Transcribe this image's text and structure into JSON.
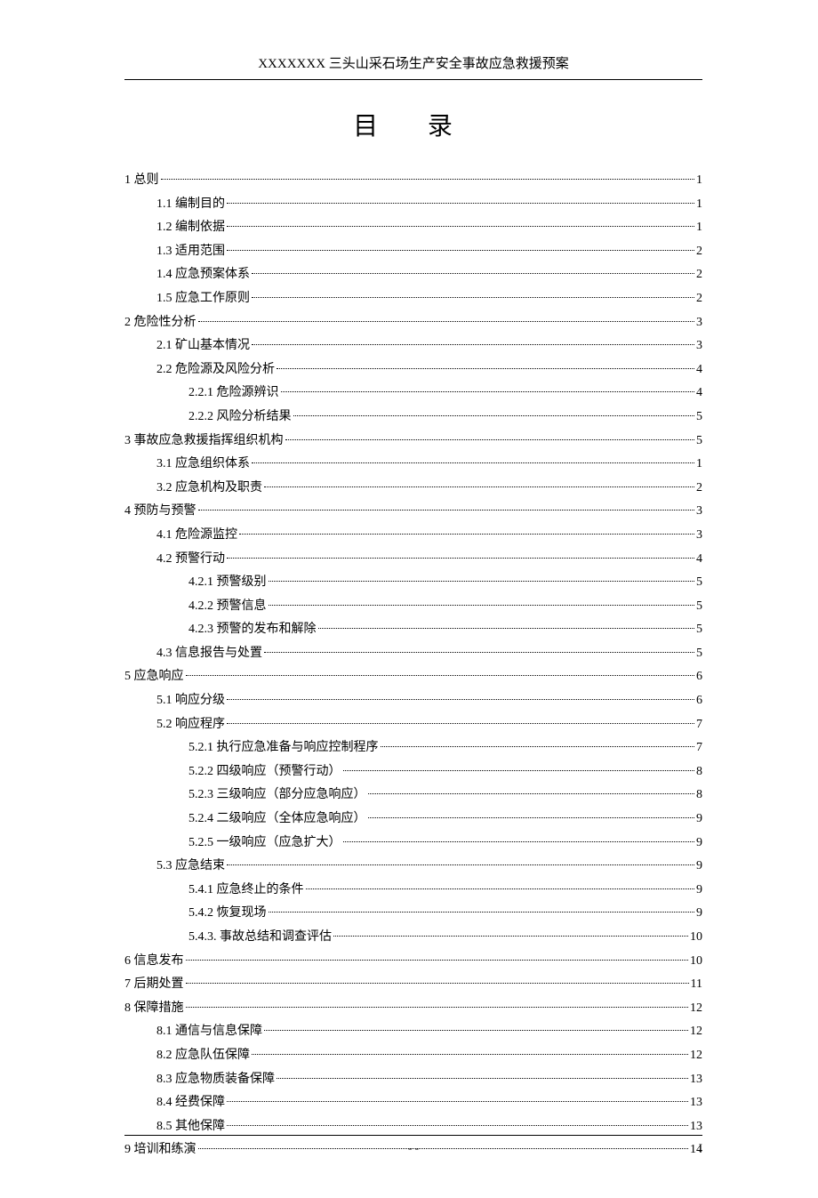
{
  "header": "XXXXXXX 三头山采石场生产安全事故应急救援预案",
  "title": "目 录",
  "footer_center": "-  -",
  "footer_right": "I",
  "toc": [
    {
      "level": 1,
      "label": "1 总则",
      "page": "1"
    },
    {
      "level": 2,
      "label": "1.1 编制目的",
      "page": "1"
    },
    {
      "level": 2,
      "label": "1.2 编制依据",
      "page": "1"
    },
    {
      "level": 2,
      "label": "1.3 适用范围",
      "page": "2"
    },
    {
      "level": 2,
      "label": "1.4 应急预案体系",
      "page": "2"
    },
    {
      "level": 2,
      "label": "1.5 应急工作原则",
      "page": "2"
    },
    {
      "level": 1,
      "label": "2 危险性分析",
      "page": "3"
    },
    {
      "level": 2,
      "label": "2.1 矿山基本情况",
      "page": "3"
    },
    {
      "level": 2,
      "label": "2.2 危险源及风险分析",
      "page": "4"
    },
    {
      "level": 3,
      "label": "2.2.1 危险源辨识",
      "page": "4"
    },
    {
      "level": 3,
      "label": "2.2.2 风险分析结果",
      "page": "5"
    },
    {
      "level": 1,
      "label": "3 事故应急救援指挥组织机构",
      "page": "5"
    },
    {
      "level": 2,
      "label": "3.1 应急组织体系",
      "page": "1"
    },
    {
      "level": 2,
      "label": "3.2 应急机构及职责",
      "page": "2"
    },
    {
      "level": 1,
      "label": "4 预防与预警",
      "page": "3"
    },
    {
      "level": 2,
      "label": "4.1 危险源监控",
      "page": "3"
    },
    {
      "level": 2,
      "label": "4.2 预警行动",
      "page": "4"
    },
    {
      "level": 3,
      "label": "4.2.1 预警级别",
      "page": "5"
    },
    {
      "level": 3,
      "label": "4.2.2 预警信息",
      "page": "5"
    },
    {
      "level": 3,
      "label": "4.2.3 预警的发布和解除",
      "page": "5"
    },
    {
      "level": 2,
      "label": "4.3 信息报告与处置",
      "page": "5"
    },
    {
      "level": 1,
      "label": "5 应急响应",
      "page": "6"
    },
    {
      "level": 2,
      "label": "5.1 响应分级",
      "page": "6"
    },
    {
      "level": 2,
      "label": "5.2 响应程序",
      "page": "7"
    },
    {
      "level": 3,
      "label": "5.2.1 执行应急准备与响应控制程序",
      "page": "7"
    },
    {
      "level": 3,
      "label": "5.2.2 四级响应（预警行动）",
      "page": "8"
    },
    {
      "level": 3,
      "label": "5.2.3 三级响应（部分应急响应）",
      "page": "8"
    },
    {
      "level": 3,
      "label": "5.2.4 二级响应（全体应急响应）",
      "page": "9"
    },
    {
      "level": 3,
      "label": "5.2.5 一级响应（应急扩大）",
      "page": "9"
    },
    {
      "level": 2,
      "label": "5.3 应急结束",
      "page": "9"
    },
    {
      "level": 3,
      "label": "5.4.1 应急终止的条件",
      "page": "9"
    },
    {
      "level": 3,
      "label": "5.4.2 恢复现场",
      "page": "9"
    },
    {
      "level": 3,
      "label": "5.4.3. 事故总结和调查评估",
      "page": "10"
    },
    {
      "level": 1,
      "label": "6 信息发布",
      "page": "10"
    },
    {
      "level": 1,
      "label": "7 后期处置",
      "page": "11"
    },
    {
      "level": 1,
      "label": "8 保障措施",
      "page": "12"
    },
    {
      "level": 2,
      "label": "8.1 通信与信息保障",
      "page": "12"
    },
    {
      "level": 2,
      "label": "8.2 应急队伍保障",
      "page": "12"
    },
    {
      "level": 2,
      "label": "8.3 应急物质装备保障",
      "page": "13"
    },
    {
      "level": 2,
      "label": "8.4 经费保障",
      "page": "13"
    },
    {
      "level": 2,
      "label": "8.5 其他保障",
      "page": "13"
    },
    {
      "level": 1,
      "label": "9 培训和练演",
      "page": "14"
    }
  ]
}
